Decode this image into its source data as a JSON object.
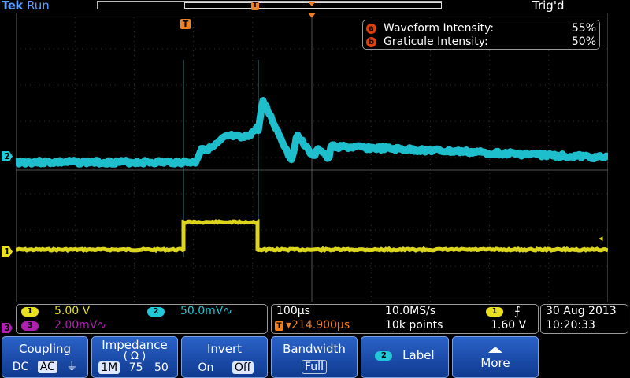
{
  "header": {
    "brand": "Tek",
    "run_state": "Run",
    "trigger_status": "Trig'd"
  },
  "markers": {
    "trigger_label": "T",
    "ch1": "1",
    "ch2": "2",
    "ch3": "3",
    "left_trigger_arrow": "◂"
  },
  "intensity": {
    "waveform_badge": "a",
    "waveform_label": "Waveform Intensity:",
    "waveform_value": "55%",
    "graticule_badge": "b",
    "graticule_label": "Graticule Intensity:",
    "graticule_value": "50%"
  },
  "status": {
    "ch1_scale": "5.00 V",
    "ch2_scale": "50.0mV∿",
    "ch3_scale": "2.00mV∿",
    "timebase": "100µs",
    "sample_rate": "10.0MS/s",
    "trigger_position": "▾214.900µs",
    "record_length": "10k points",
    "trigger_source": "1",
    "trigger_slope_icon": "rising-edge-icon",
    "trigger_slope_glyph": "⨍",
    "trigger_level": "1.60 V",
    "date": "30 Aug 2013",
    "time": "10:20:33"
  },
  "softkeys": [
    {
      "title": "Coupling",
      "options": [
        "DC",
        "AC",
        "⏚"
      ],
      "selected": 1
    },
    {
      "title": "Impedance",
      "subtitle": "( Ω )",
      "options": [
        "1M",
        "75",
        "50"
      ],
      "selected": 0
    },
    {
      "title": "Invert",
      "options": [
        "On",
        "Off"
      ],
      "selected": 1
    },
    {
      "title": "Bandwidth",
      "value": "Full"
    },
    {
      "badge": "2",
      "title": "Label"
    },
    {
      "title": "More"
    }
  ],
  "colors": {
    "ch1": "#e8e020",
    "ch2": "#20c8d8",
    "ch3": "#b020b0",
    "accent": "#f08020",
    "brand": "#5aa0ff"
  }
}
